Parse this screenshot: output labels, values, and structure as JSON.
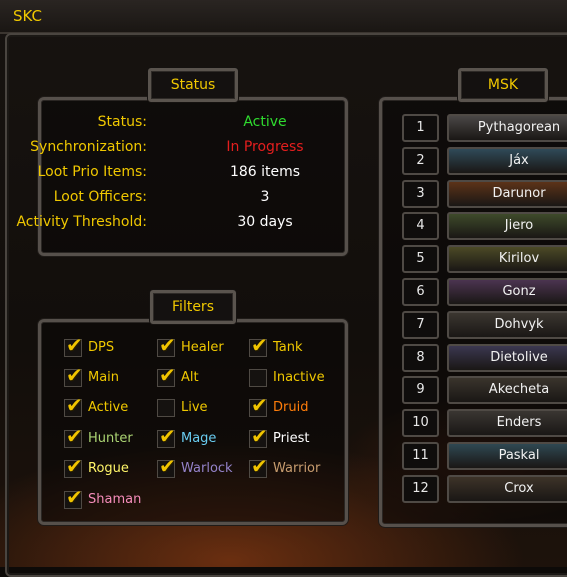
{
  "window": {
    "title": "SKC"
  },
  "status_panel": {
    "label": "Status",
    "rows": [
      {
        "key": "Status:",
        "value": "Active",
        "color": "#2fdc2f"
      },
      {
        "key": "Synchronization:",
        "value": "In Progress",
        "color": "#e41e1e"
      },
      {
        "key": "Loot Prio Items:",
        "value": "186 items",
        "color": "#ffffff"
      },
      {
        "key": "Loot Officers:",
        "value": "3",
        "color": "#ffffff"
      },
      {
        "key": "Activity Threshold:",
        "value": "30 days",
        "color": "#ffffff"
      }
    ]
  },
  "filters_panel": {
    "label": "Filters",
    "items": [
      {
        "label": "DPS",
        "checked": true,
        "color": "#f0c800"
      },
      {
        "label": "Healer",
        "checked": true,
        "color": "#f0c800"
      },
      {
        "label": "Tank",
        "checked": true,
        "color": "#f0c800"
      },
      {
        "label": "Main",
        "checked": true,
        "color": "#f0c800"
      },
      {
        "label": "Alt",
        "checked": true,
        "color": "#f0c800"
      },
      {
        "label": "Inactive",
        "checked": false,
        "color": "#f0c800"
      },
      {
        "label": "Active",
        "checked": true,
        "color": "#f0c800"
      },
      {
        "label": "Live",
        "checked": false,
        "color": "#f0c800"
      },
      {
        "label": "Druid",
        "checked": true,
        "color": "#ff7d0a"
      },
      {
        "label": "Hunter",
        "checked": true,
        "color": "#abd473"
      },
      {
        "label": "Mage",
        "checked": true,
        "color": "#69ccf0"
      },
      {
        "label": "Priest",
        "checked": true,
        "color": "#ffffff"
      },
      {
        "label": "Rogue",
        "checked": true,
        "color": "#fff569"
      },
      {
        "label": "Warlock",
        "checked": true,
        "color": "#9482c9"
      },
      {
        "label": "Warrior",
        "checked": true,
        "color": "#c79c6e"
      },
      {
        "label": "Shaman",
        "checked": true,
        "color": "#f58cba"
      }
    ]
  },
  "msk_panel": {
    "label": "MSK",
    "rows": [
      {
        "rank": "1",
        "name": "Pythagorean",
        "color": "#4a4746"
      },
      {
        "rank": "2",
        "name": "Jáx",
        "color": "#2f4a58"
      },
      {
        "rank": "3",
        "name": "Darunor",
        "color": "#5c3318"
      },
      {
        "rank": "4",
        "name": "Jiero",
        "color": "#3e4a2a"
      },
      {
        "rank": "5",
        "name": "Kirilov",
        "color": "#4c4a26"
      },
      {
        "rank": "6",
        "name": "Gonz",
        "color": "#4b3450"
      },
      {
        "rank": "7",
        "name": "Dohvyk",
        "color": "#3b3630"
      },
      {
        "rank": "8",
        "name": "Dietolive",
        "color": "#3b3750"
      },
      {
        "rank": "9",
        "name": "Akecheta",
        "color": "#3a342c"
      },
      {
        "rank": "10",
        "name": "Enders",
        "color": "#3a3632"
      },
      {
        "rank": "11",
        "name": "Paskal",
        "color": "#2f4852"
      },
      {
        "rank": "12",
        "name": "Crox",
        "color": "#3d3328"
      }
    ]
  }
}
